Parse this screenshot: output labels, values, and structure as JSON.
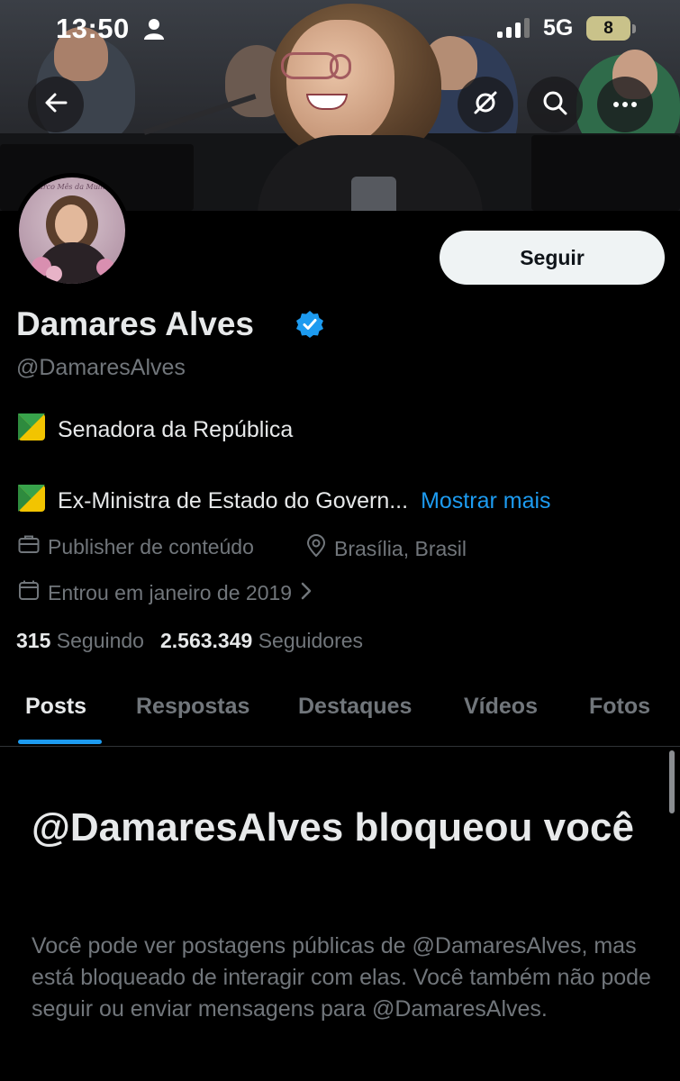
{
  "status_bar": {
    "time": "13:50",
    "network": "5G",
    "battery": "8"
  },
  "profile": {
    "name": "Damares Alves",
    "handle": "@DamaresAlves",
    "follow_label": "Seguir",
    "avatar_text": "Marco Mês da Mulher",
    "bio_line_1": "Senadora da República",
    "bio_line_2": "Ex-Ministra de Estado do Govern...",
    "show_more": "Mostrar mais",
    "category": "Publisher de conteúdo",
    "location": "Brasília, Brasil",
    "joined": "Entrou em janeiro de 2019",
    "following_count": "315",
    "following_label": "Seguindo",
    "followers_count": "2.563.349",
    "followers_label": "Seguidores"
  },
  "tabs": [
    {
      "label": "Posts",
      "active": true
    },
    {
      "label": "Respostas"
    },
    {
      "label": "Destaques"
    },
    {
      "label": "Vídeos"
    },
    {
      "label": "Fotos"
    }
  ],
  "blocked": {
    "title": "@DamaresAlves bloqueou você",
    "body": "Você pode ver postagens públicas de @DamaresAlves, mas está bloqueado de interagir com elas. Você também não pode seguir ou enviar mensagens para @DamaresAlves."
  },
  "colors": {
    "accent": "#1d9bf0",
    "verified": "#1d9bf0",
    "secondary_text": "#71767b",
    "background": "#000000"
  },
  "icons": [
    "person-icon",
    "signal-icon",
    "back-arrow-icon",
    "grok-icon",
    "search-icon",
    "more-icon",
    "verified-badge-icon",
    "leaf-icon",
    "briefcase-icon",
    "location-pin-icon",
    "calendar-icon",
    "chevron-right-icon"
  ]
}
